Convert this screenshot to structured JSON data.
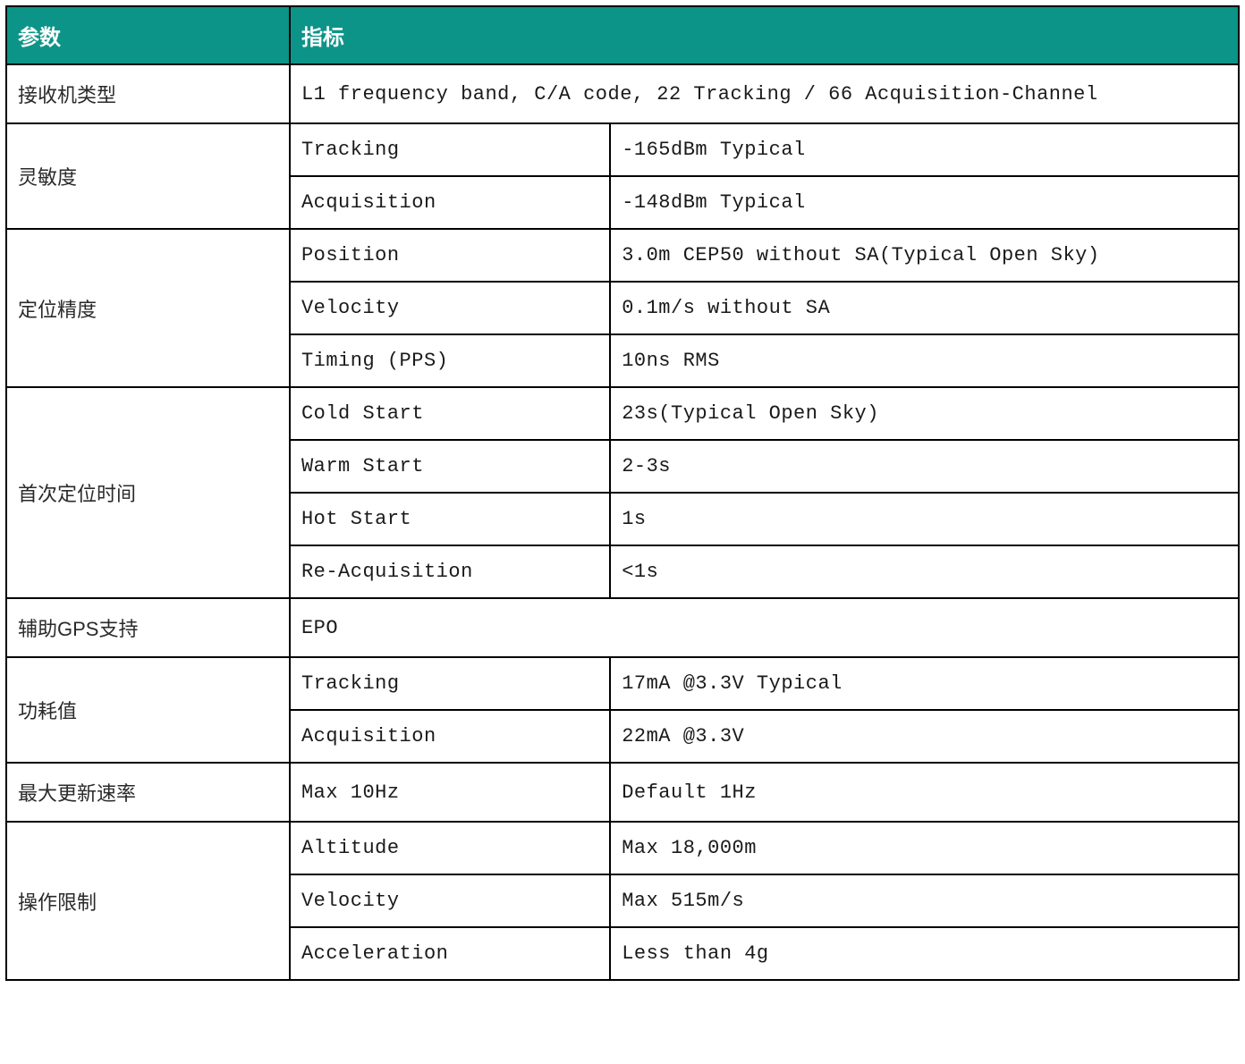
{
  "header": {
    "param": "参数",
    "indicator": "指标"
  },
  "rows": {
    "receiver_type": {
      "label": "接收机类型",
      "value": "L1 frequency band,  C/A code,  22 Tracking / 66 Acquisition-Channel"
    },
    "sensitivity": {
      "label": "灵敏度",
      "tracking_label": "Tracking",
      "tracking_value": "-165dBm Typical",
      "acquisition_label": "Acquisition",
      "acquisition_value": "-148dBm Typical"
    },
    "accuracy": {
      "label": "定位精度",
      "position_label": "Position",
      "position_value": "3.0m CEP50 without SA(Typical Open Sky)",
      "velocity_label": "Velocity",
      "velocity_value": "0.1m/s without SA",
      "timing_label": "Timing (PPS)",
      "timing_value": "10ns RMS"
    },
    "ttff": {
      "label": "首次定位时间",
      "cold_label": "Cold Start",
      "cold_value": "23s(Typical Open Sky)",
      "warm_label": "Warm Start",
      "warm_value": "2-3s",
      "hot_label": "Hot Start",
      "hot_value": "1s",
      "reacq_label": "Re-Acquisition",
      "reacq_value": "<1s"
    },
    "agps": {
      "label": "辅助GPS支持",
      "value": "EPO"
    },
    "power": {
      "label": "功耗值",
      "tracking_label": "Tracking",
      "tracking_value": "17mA @3.3V Typical",
      "acquisition_label": "Acquisition",
      "acquisition_value": "22mA @3.3V"
    },
    "update_rate": {
      "label": "最大更新速率",
      "max_label": "Max 10Hz",
      "default_label": "Default 1Hz"
    },
    "limits": {
      "label": "操作限制",
      "altitude_label": "Altitude",
      "altitude_value": "Max 18,000m",
      "velocity_label": "Velocity",
      "velocity_value": "Max 515m/s",
      "acceleration_label": "Acceleration",
      "acceleration_value": "Less than 4g"
    }
  }
}
